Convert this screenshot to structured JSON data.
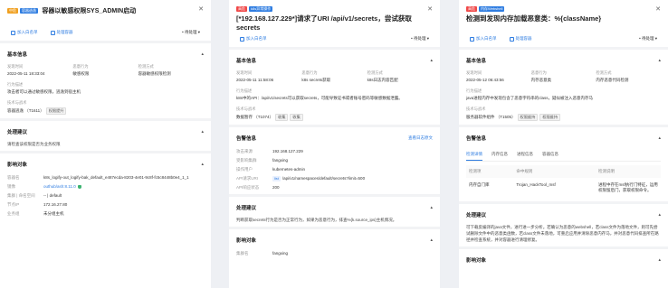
{
  "panel1": {
    "severity": "中危",
    "category": "容器逃逸",
    "title": "容器以敏感权限SYS_ADMIN启动",
    "actions": {
      "add_whitelist": "加入白名单",
      "handle_container": "处理容器",
      "status": "• 待处理"
    },
    "basic": {
      "heading": "基本信息",
      "fields": [
        {
          "label": "发现时间",
          "value": "2022-05-11 18:33:04"
        },
        {
          "label": "恶意行为",
          "value": "敏感权限"
        },
        {
          "label": "检测方式",
          "value": "容器敏感权限检测"
        }
      ],
      "behavior_label": "行为描述",
      "behavior_text": "攻击者可以通过敏感权限，逃逸到宿主机",
      "tech_label": "技术与战术",
      "tech_text": "容器逃逸 （T1611）",
      "tech_chips": [
        "权限提升"
      ]
    },
    "advice": {
      "heading": "处理建议",
      "text": "请检查该权限是否为业务权限"
    },
    "impact": {
      "heading": "影响对象",
      "rows": [
        {
          "label": "容器名",
          "value": "k8s_logify-out_logify-bak_default_e487ecda-8203-4e01-9c8f-fc5c8448b0e4_1_1"
        },
        {
          "label": "镜像",
          "value": "outhub/ash:8.11.0"
        },
        {
          "label": "集群 | 命名空间",
          "value": "-- | default"
        },
        {
          "label": "节点IP",
          "value": "172.16.27.80"
        },
        {
          "label": "业务组",
          "value": "未分组主机"
        }
      ]
    }
  },
  "panel2": {
    "severity": "高危",
    "category": "k8s异常操作",
    "title": "[*192.168.127.229*]请求了URI /api/v1/secrets，尝试获取secrets",
    "actions": {
      "add_whitelist": "加入白名单",
      "status": "• 待处理"
    },
    "basic": {
      "heading": "基本信息",
      "fields": [
        {
          "label": "发现时间",
          "value": "2022-05-11 11:58:06"
        },
        {
          "label": "恶意行为",
          "value": "k8s secrets获取"
        },
        {
          "label": "检测方式",
          "value": "k8s日志内容匹配"
        }
      ],
      "behavior_label": "行为描述",
      "behavior_text": "k8s中的API：/api/v1/secrets可以获取secrets，可能导致证书或者账号密码等敏感数据泄露。",
      "tech_label": "技术与战术",
      "tech_text": "数据暂存 （T1074）",
      "tech_chips": [
        "收集",
        "收集"
      ]
    },
    "source": {
      "heading": "告警信息",
      "link": "查看日志原文",
      "rows": [
        {
          "label": "攻击来源",
          "value": "192.168.127.229"
        },
        {
          "label": "受影响集群",
          "value": "fangxing"
        },
        {
          "label": "操作用户",
          "value": "kubernetes-admin"
        },
        {
          "label": "API请求URI",
          "method": "list",
          "value": "/api/v1/namespaces/default/secrets?limit=500"
        },
        {
          "label": "API响应状态",
          "value": "200"
        }
      ]
    },
    "advice": {
      "heading": "处理建议",
      "text": "判断获取secrets行为是否为正常行为，如果为恶意行为，排查%{k.source_ips}主机情况。"
    },
    "impact": {
      "heading": "影响对象",
      "rows": [
        {
          "label": "集群名",
          "value": "fangxing"
        }
      ]
    }
  },
  "panel3": {
    "severity": "高危",
    "category": "内存Webshell",
    "title": "检测到发现内存加载恶意类：%{className}",
    "actions": {
      "add_whitelist": "加入白名单",
      "handle_container": "处理容器",
      "status": "• 待处理"
    },
    "basic": {
      "heading": "基本信息",
      "fields": [
        {
          "label": "发现时间",
          "value": "2022-05-12 06:43:56"
        },
        {
          "label": "恶意行为",
          "value": "内存恶意类"
        },
        {
          "label": "检测方式",
          "value": "内存恶意代码检测"
        }
      ],
      "behavior_label": "行为描述",
      "behavior_text": "java进程内存中发现包含了恶意字符串的class，疑似被注入恶意内存马",
      "tech_label": "技术与战术",
      "tech_text": "服务器软件组件 （T1505）",
      "tech_chips": [
        "权限维持",
        "权限维持"
      ]
    },
    "alert": {
      "heading": "告警信息",
      "tabs": [
        "检测详情",
        "内存信息",
        "进程信息",
        "容器信息"
      ],
      "columns": [
        "检测项",
        "命中规则",
        "检测说明"
      ],
      "rows": [
        {
          "item": "内存自门库",
          "rule": "Trojan_HackTool_msf",
          "desc": "进程中存在msf执行门特征，运用权限留后门，获取权限命令。"
        }
      ]
    },
    "advice": {
      "heading": "处理建议",
      "text": "可下载反编译的java文件，进行进一步分析。若确认为恶意的webshell，若class文件为落地文件，则可先尝试删除文件中的恶意类函数，若class文件未落地，可重启应用并清除恶意内存马，并对恶意代码排查所在路径并检查系统，并对容器进行清理修复。"
    },
    "impact": {
      "heading": "影响对象"
    }
  },
  "colors": {
    "accent": "#2f7de1",
    "high": "#f04848",
    "mid": "#f0a020"
  }
}
